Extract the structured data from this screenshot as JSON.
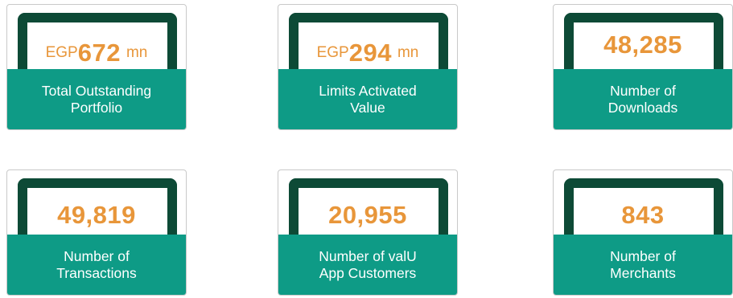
{
  "cards": [
    {
      "prefix": "EGP",
      "value": "672",
      "unit": "mn",
      "label_line1": "Total Outstanding",
      "label_line2": "Portfolio"
    },
    {
      "prefix": "EGP",
      "value": "294",
      "unit": "mn",
      "label_line1": "Limits Activated",
      "label_line2": "Value"
    },
    {
      "value": "48,285",
      "label_line1": "Number of",
      "label_line2": "Downloads"
    },
    {
      "value": "49,819",
      "label_line1": "Number of",
      "label_line2": "Transactions"
    },
    {
      "value": "20,955",
      "label_line1": "Number of valU",
      "label_line2": "App Customers"
    },
    {
      "value": "843",
      "label_line1": "Number of",
      "label_line2": "Merchants"
    }
  ],
  "colors": {
    "frame": "#0d4a36",
    "value": "#e8963a",
    "label_bg": "#0e9b86",
    "label_text": "#ffffff"
  }
}
